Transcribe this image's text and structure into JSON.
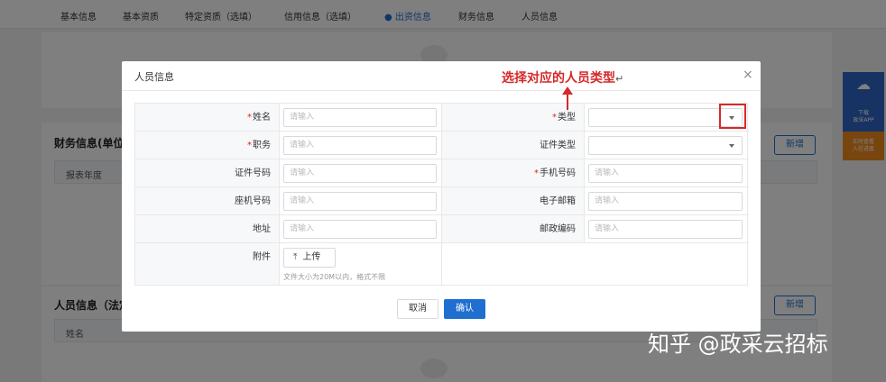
{
  "bg": {
    "tabs": [
      "基本信息",
      "基本资质",
      "特定资质（选填）",
      "信用信息（选填）",
      "出资信息",
      "财务信息",
      "人员信息"
    ],
    "finance_title": "财务信息(单位",
    "finance_col1": "报表年度",
    "personnel_title": "人员信息（法定",
    "personnel_col1": "姓名",
    "new_button": "新增",
    "side_download": "下载\n政采APP",
    "side_sub": "实时查看\n入驻进度"
  },
  "modal": {
    "title": "人员信息",
    "close": "×",
    "placeholder": "请输入",
    "fields": {
      "name": "姓名",
      "type": "类型",
      "position": "职务",
      "cert_type": "证件类型",
      "cert_no": "证件号码",
      "mobile": "手机号码",
      "landline": "座机号码",
      "email": "电子邮箱",
      "address": "地址",
      "postcode": "邮政编码",
      "attachment": "附件"
    },
    "upload_label": "上传",
    "upload_hint": "文件大小为20M以内，格式不限",
    "cancel": "取消",
    "confirm": "确认"
  },
  "annotation": {
    "text": "选择对应的人员类型",
    "enter_mark": "↵"
  },
  "watermark": "知乎 @政采云招标",
  "colors": {
    "primary": "#1f6fd0",
    "required": "#e02020",
    "annotation": "#d42a2a"
  }
}
